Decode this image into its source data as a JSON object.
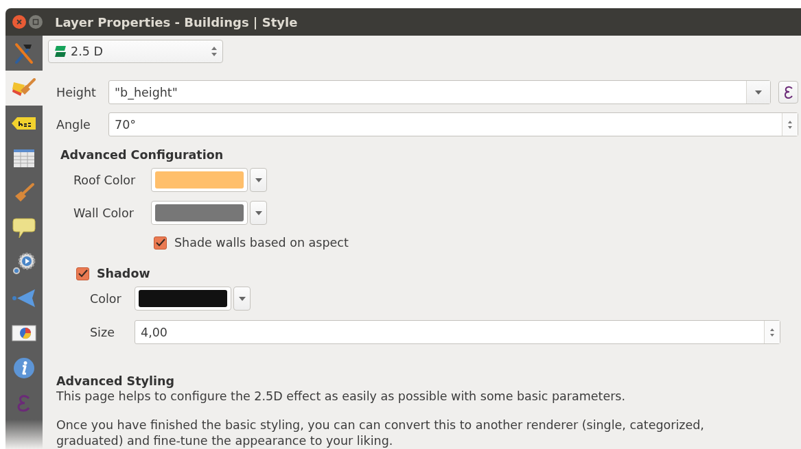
{
  "window": {
    "title": "Layer Properties - Buildings | Style"
  },
  "sidebar": {
    "items": [
      {
        "kind": "tools",
        "selected": false
      },
      {
        "kind": "style",
        "selected": true
      },
      {
        "kind": "labels",
        "selected": false
      },
      {
        "kind": "fields",
        "selected": false
      },
      {
        "kind": "rendering",
        "selected": false
      },
      {
        "kind": "display",
        "selected": false
      },
      {
        "kind": "actions",
        "selected": false
      },
      {
        "kind": "joins",
        "selected": false
      },
      {
        "kind": "diagrams",
        "selected": false
      },
      {
        "kind": "metadata",
        "selected": false
      },
      {
        "kind": "variables",
        "selected": false
      }
    ]
  },
  "renderer": {
    "value": "2.5 D"
  },
  "height": {
    "label": "Height",
    "value": "\"b_height\""
  },
  "angle": {
    "label": "Angle",
    "value": "70°"
  },
  "advanced_configuration": {
    "title": "Advanced Configuration",
    "roof_color": {
      "label": "Roof Color",
      "color": "#ffbf6b"
    },
    "wall_color": {
      "label": "Wall Color",
      "color": "#777777"
    },
    "shade_walls": {
      "label": "Shade walls based on aspect",
      "checked": true
    }
  },
  "shadow": {
    "label": "Shadow",
    "checked": true,
    "color": {
      "label": "Color",
      "color": "#111111"
    },
    "size": {
      "label": "Size",
      "value": "4,00"
    }
  },
  "help": {
    "title": "Advanced Styling",
    "paragraphs": [
      "This page helps to configure the 2.5D effect as easily as possible with some basic parameters.",
      "Once you have finished the basic styling, you can can convert this to another renderer (single, categorized, graduated) and fine-tune the appearance to your liking."
    ]
  }
}
